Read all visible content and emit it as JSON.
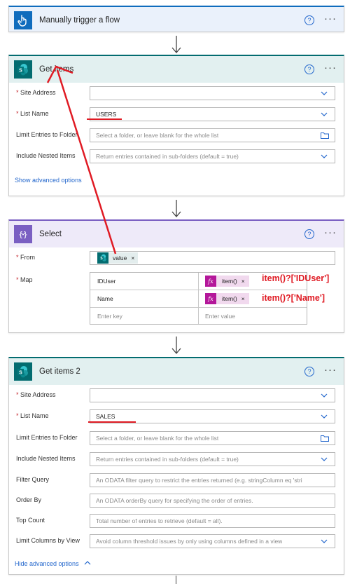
{
  "trigger": {
    "title": "Manually trigger a flow",
    "help": "?",
    "more": "···",
    "color": "#0f6cbd"
  },
  "get_items": {
    "title": "Get items",
    "help": "?",
    "more": "···",
    "fields": [
      {
        "label": "Site Address",
        "required": true,
        "value": "",
        "placeholder": ""
      },
      {
        "label": "List Name",
        "required": true,
        "value": "USERS",
        "placeholder": ""
      },
      {
        "label": "Limit Entries to Folder",
        "required": false,
        "value": "",
        "placeholder": "Select a folder, or leave blank for the whole list"
      },
      {
        "label": "Include Nested Items",
        "required": false,
        "value": "",
        "placeholder": "Return entries contained in sub-folders (default = true)"
      }
    ],
    "advanced_link": "Show advanced options"
  },
  "select": {
    "title": "Select",
    "help": "?",
    "more": "···",
    "from_label": "From",
    "from_token": "value",
    "token_close": "×",
    "map_label": "Map",
    "rows": [
      {
        "key": "IDUser",
        "value": "item()"
      },
      {
        "key": "Name",
        "value": "item()"
      }
    ],
    "key_placeholder": "Enter key",
    "value_placeholder": "Enter value",
    "fx": "fx",
    "color": "#7a5fc2"
  },
  "get_items_2": {
    "title": "Get items 2",
    "help": "?",
    "more": "···",
    "fields": [
      {
        "label": "Site Address",
        "required": true,
        "value": "",
        "placeholder": ""
      },
      {
        "label": "List Name",
        "required": true,
        "value": "SALES",
        "placeholder": ""
      },
      {
        "label": "Limit Entries to Folder",
        "required": false,
        "value": "",
        "placeholder": "Select a folder, or leave blank for the whole list"
      },
      {
        "label": "Include Nested Items",
        "required": false,
        "value": "",
        "placeholder": "Return entries contained in sub-folders (default = true)"
      },
      {
        "label": "Filter Query",
        "required": false,
        "value": "",
        "placeholder": "An ODATA filter query to restrict the entries returned (e.g. stringColumn eq 'stri"
      },
      {
        "label": "Order By",
        "required": false,
        "value": "",
        "placeholder": "An ODATA orderBy query for specifying the order of entries."
      },
      {
        "label": "Top Count",
        "required": false,
        "value": "",
        "placeholder": "Total number of entries to retrieve (default = all)."
      },
      {
        "label": "Limit Columns by View",
        "required": false,
        "value": "",
        "placeholder": "Avoid column threshold issues by only using columns defined in a view"
      }
    ],
    "advanced_link": "Hide advanced options"
  },
  "annotations": {
    "iduser": "item()?['IDUser']",
    "name": "item()?['Name']",
    "color": "#e01b24"
  },
  "sharepoint_color": "#036c70"
}
